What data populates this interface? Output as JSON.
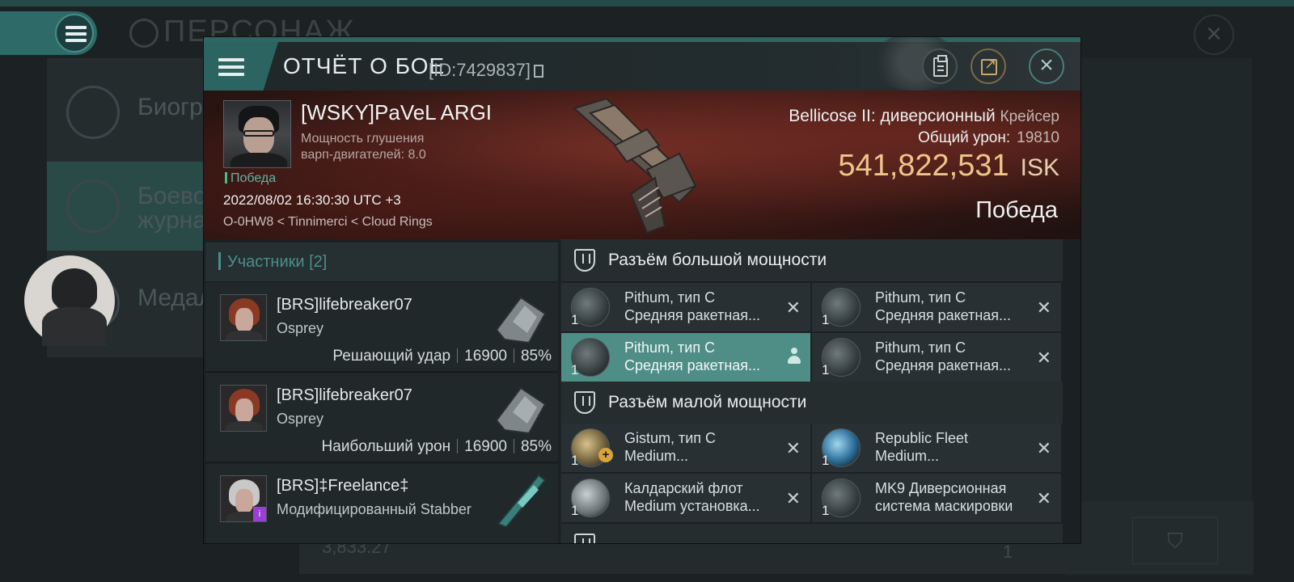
{
  "background": {
    "title": "ПЕРСОНАЖ",
    "left_items": [
      {
        "label": "Биогра"
      },
      {
        "label_line1": "Боевой",
        "label_line2": "журнал"
      },
      {
        "label": "Медал"
      }
    ],
    "bottom_value": "3,833.27",
    "page_number": "1"
  },
  "modal": {
    "title": "ОТЧЁТ О БОЕ",
    "id": "[ID:7429837]",
    "pilot": {
      "name": "[WSKY]PaVeL ARGI",
      "warp_label": "Мощность глушения",
      "warp_value": "варп-двигателей: 8.0",
      "result_tag": "Победа",
      "datetime": "2022/08/02 16:30:30 UTC +3",
      "location": "O-0HW8 < Tinnimerci < Cloud Rings"
    },
    "ship": {
      "name": "Bellicose II: диверсионный",
      "class": "Крейсер",
      "damage_label": "Общий урон:",
      "damage_value": "19810",
      "isk_value": "541,822,531",
      "isk_currency": "ISK",
      "result": "Победа"
    },
    "participants": {
      "header": "Участники [2]",
      "rows": [
        {
          "name": "[BRS]lifebreaker07",
          "ship": "Osprey",
          "role": "Решающий удар",
          "damage": "16900",
          "percent": "85%"
        },
        {
          "name": "[BRS]lifebreaker07",
          "ship": "Osprey",
          "role": "Наибольший урон",
          "damage": "16900",
          "percent": "85%"
        },
        {
          "name": "[BRS]‡Freelance‡",
          "ship": "Модифицированный Stabber"
        }
      ]
    },
    "slots": {
      "high": {
        "label": "Разъём большой мощности",
        "modules": [
          {
            "qty": "1",
            "line1": "Pithum, тип C",
            "line2": "Средняя ракетная..."
          },
          {
            "qty": "1",
            "line1": "Pithum, тип C",
            "line2": "Средняя ракетная..."
          },
          {
            "qty": "1",
            "line1": "Pithum, тип C",
            "line2": "Средняя ракетная..."
          },
          {
            "qty": "1",
            "line1": "Pithum, тип C",
            "line2": "Средняя ракетная..."
          }
        ]
      },
      "low": {
        "label": "Разъём малой мощности",
        "modules": [
          {
            "qty": "1",
            "line1": "Gistum, тип C",
            "line2": "Medium..."
          },
          {
            "qty": "1",
            "line1": "Republic Fleet",
            "line2": "Medium..."
          },
          {
            "qty": "1",
            "line1": "Калдарский флот",
            "line2": "Medium установка..."
          },
          {
            "qty": "1",
            "line1": "MK9 Диверсионная",
            "line2": "система маскировки"
          }
        ]
      }
    }
  },
  "icons": [
    "menu-icon",
    "clipboard-icon",
    "share-icon",
    "close-icon",
    "shield-slot-icon",
    "remove-icon",
    "person-icon",
    "filter-icon"
  ],
  "colors": {
    "accent": "#2f6662",
    "isk": "#eec58a",
    "victory": "#42c28a",
    "selected_module": "#4f8d87"
  }
}
